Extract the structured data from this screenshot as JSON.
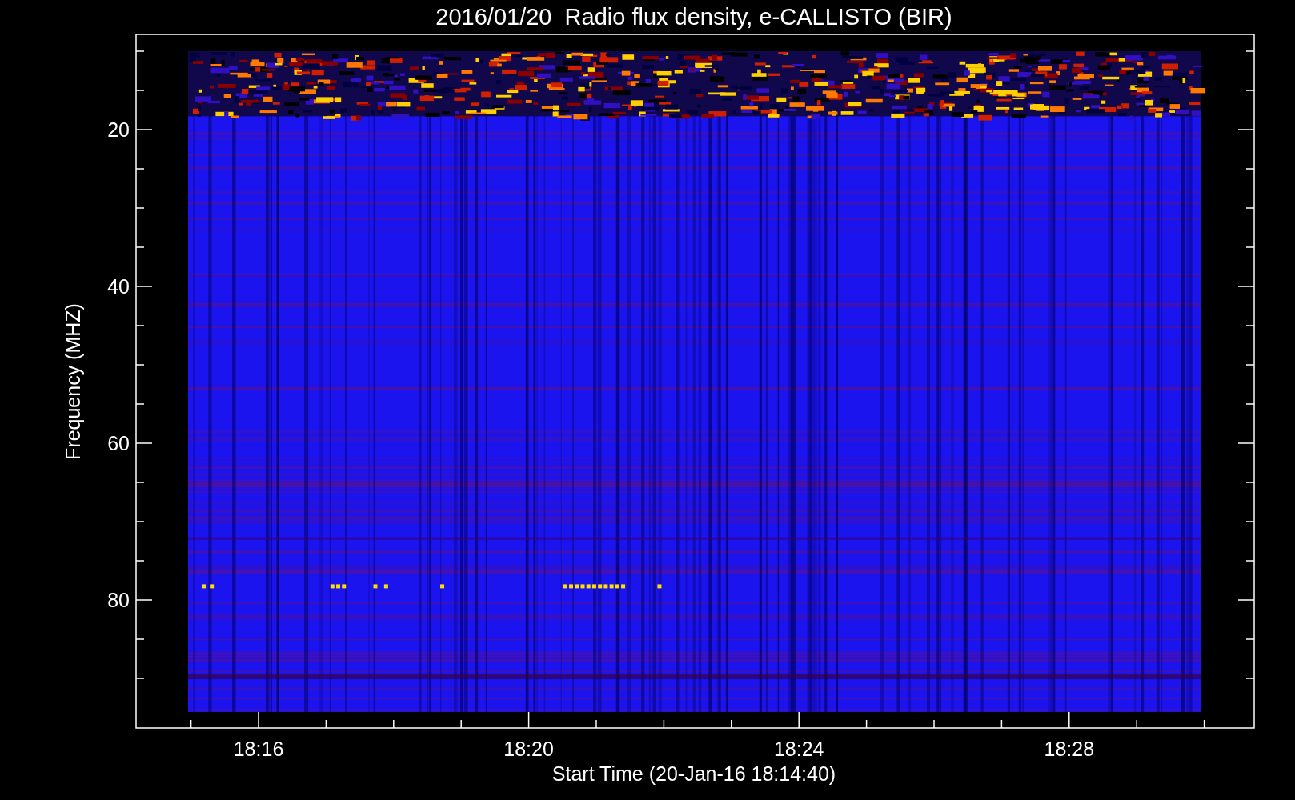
{
  "title": "2016/01/20  Radio flux density, e-CALLISTO (BIR)",
  "y_axis": {
    "label": "Frequency (MHZ)",
    "ticks": [
      "20",
      "40",
      "60",
      "80"
    ]
  },
  "x_axis": {
    "label": "Start Time (20-Jan-16 18:14:40)",
    "ticks": [
      "18:16",
      "18:20",
      "18:24",
      "18:28"
    ]
  }
}
